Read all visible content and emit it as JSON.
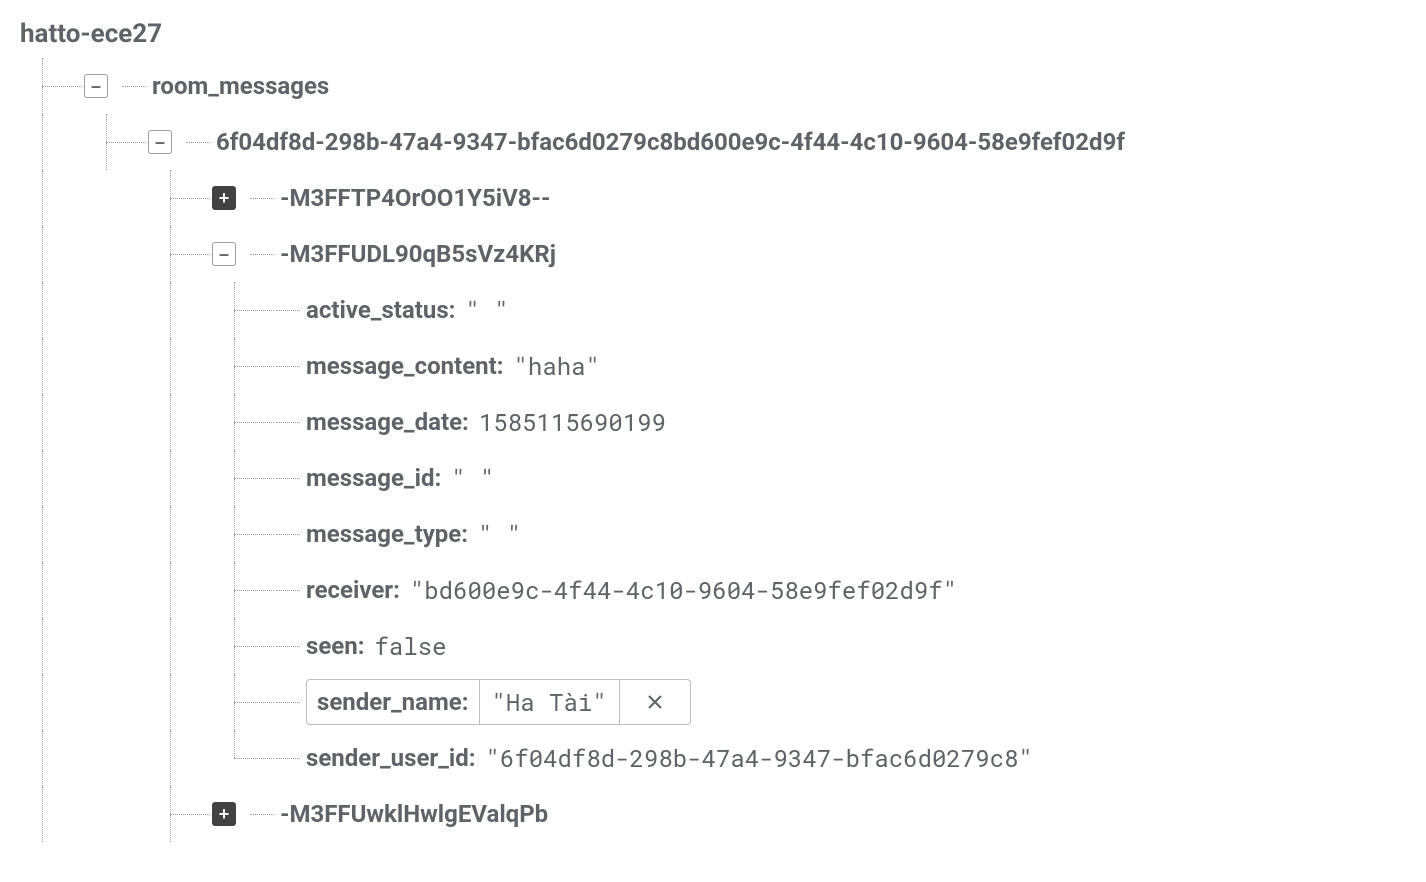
{
  "root": "hatto-ece27",
  "n1": {
    "key": "room_messages"
  },
  "n2": {
    "key": "6f04df8d-298b-47a4-9347-bfac6d0279c8bd600e9c-4f44-4c10-9604-58e9fef02d9f"
  },
  "n3": {
    "key": "-M3FFTP4OrOO1Y5iV8--"
  },
  "n4": {
    "key": "-M3FFUDL90qB5sVz4KRj"
  },
  "fields": {
    "active_status": {
      "k": "active_status",
      "v": "\" \""
    },
    "message_content": {
      "k": "message_content",
      "v": "\"haha\""
    },
    "message_date": {
      "k": "message_date",
      "v": "1585115690199"
    },
    "message_id": {
      "k": "message_id",
      "v": "\" \""
    },
    "message_type": {
      "k": "message_type",
      "v": "\" \""
    },
    "receiver": {
      "k": "receiver",
      "v": "\"bd600e9c-4f44-4c10-9604-58e9fef02d9f\""
    },
    "seen": {
      "k": "seen",
      "v": "false"
    },
    "sender_name": {
      "k": "sender_name",
      "v": "\"Ha Tài\""
    },
    "sender_user_id": {
      "k": "sender_user_id",
      "v": "\"6f04df8d-298b-47a4-9347-bfac6d0279c8\""
    }
  },
  "n5": {
    "key": "-M3FFUwklHwlgEValqPb"
  }
}
